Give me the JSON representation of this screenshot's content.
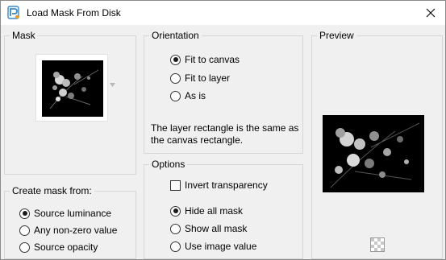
{
  "window": {
    "title": "Load Mask From Disk",
    "colors": {
      "title_bg": "#ffffff",
      "body_bg": "#f0f0f0"
    }
  },
  "mask": {
    "legend": "Mask"
  },
  "create_mask_from": {
    "legend": "Create mask from:",
    "options": [
      "Source luminance",
      "Any non-zero value",
      "Source opacity"
    ],
    "selected": "Source luminance"
  },
  "orientation": {
    "legend": "Orientation",
    "options": [
      "Fit to canvas",
      "Fit to layer",
      "As is"
    ],
    "selected": "Fit to canvas",
    "note": "The layer rectangle is the same as\nthe canvas rectangle."
  },
  "options": {
    "legend": "Options",
    "invert_transparency_label": "Invert transparency",
    "invert_transparency_checked": false,
    "mask_modes": [
      "Hide all mask",
      "Show all mask",
      "Use image value"
    ],
    "selected_mode": "Hide all mask"
  },
  "preview": {
    "legend": "Preview",
    "transparency_icon": "checkerboard-icon"
  }
}
